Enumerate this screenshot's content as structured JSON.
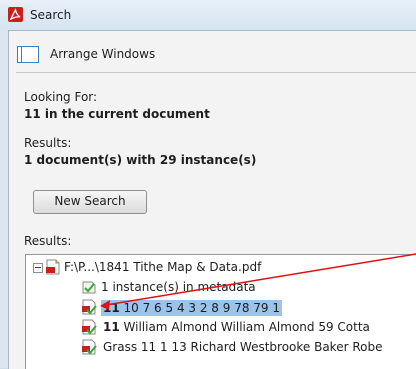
{
  "window": {
    "title": "Search"
  },
  "toolbar": {
    "arrange_label": "Arrange Windows"
  },
  "looking_for": {
    "label": "Looking For:",
    "value": "11 in the current document"
  },
  "results_summary": {
    "label": "Results:",
    "value": "1 document(s) with 29 instance(s)"
  },
  "new_search_label": "New Search",
  "results_tree": {
    "label": "Results:",
    "document": "F:\\P...\\1841 Tithe Map & Data.pdf",
    "items": [
      {
        "bold": "",
        "text": "1 instance(s) in metadata"
      },
      {
        "bold": "11",
        "text": " 10 7 6 5 4 3 2 8 9 78 79 1"
      },
      {
        "bold": "11",
        "text": " William Almond William Almond 59 Cotta"
      },
      {
        "bold": "",
        "text": "Grass 11 1 13 Richard Westbrooke Baker Robe"
      }
    ]
  },
  "colors": {
    "selection": "#9cc3ea",
    "arrow": "#e01010",
    "title_bg": "#dbe6f2"
  }
}
